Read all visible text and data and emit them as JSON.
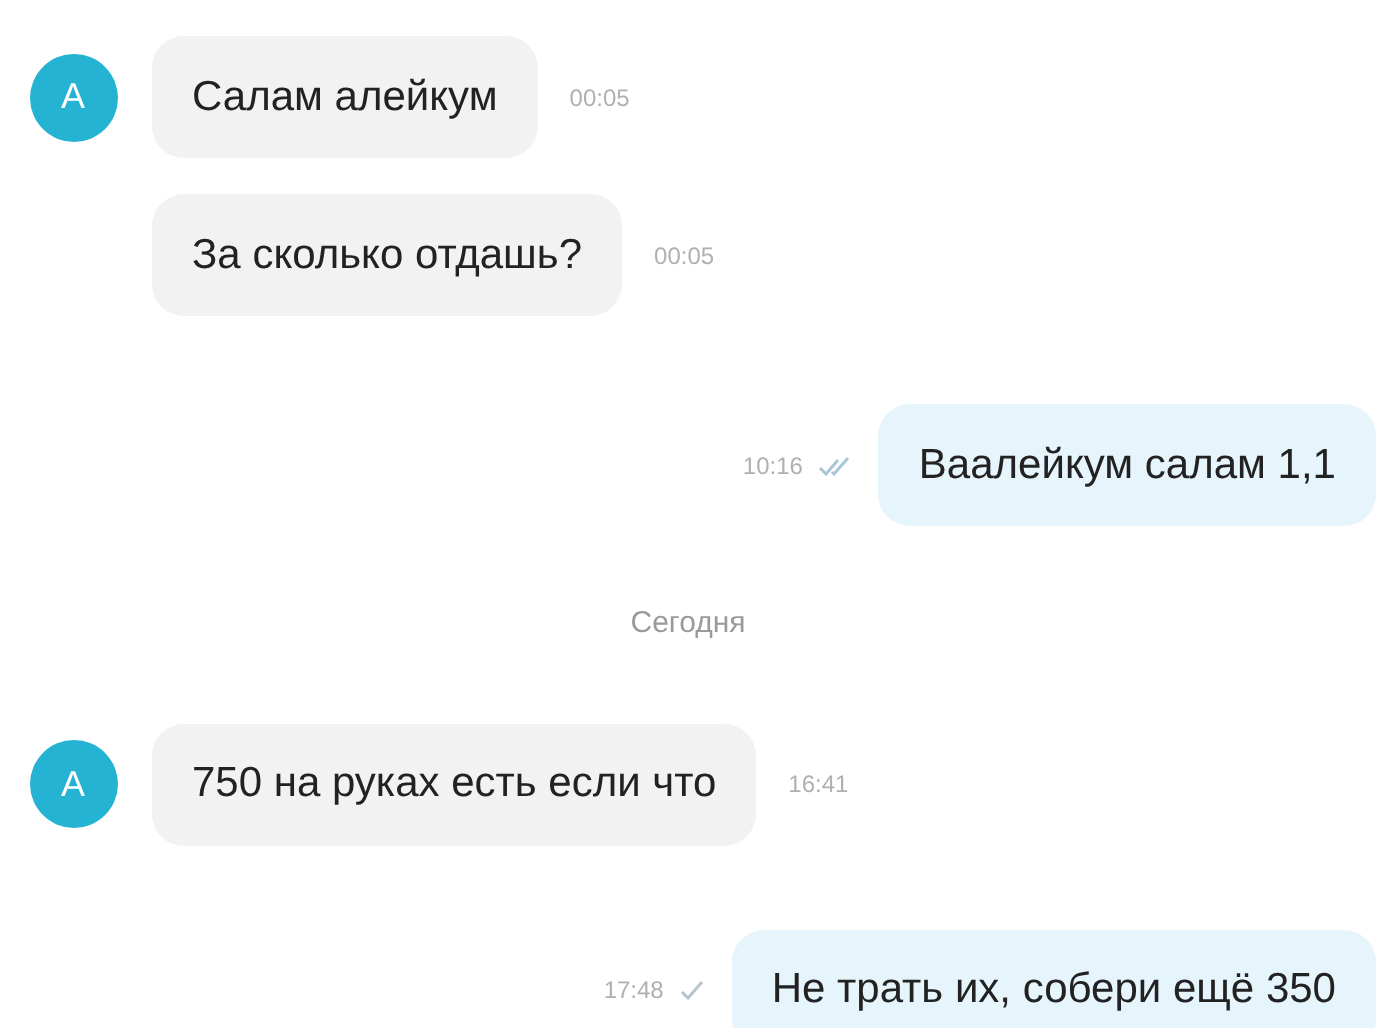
{
  "messages": [
    {
      "kind": "incoming",
      "avatar": "A",
      "text": "Салам алейкум",
      "time": "00:05"
    },
    {
      "kind": "incoming",
      "text": "За сколько отдашь?",
      "time": "00:05"
    },
    {
      "kind": "outgoing",
      "text": "Ваалейкум салам 1,1",
      "time": "10:16",
      "read": true
    },
    {
      "kind": "date",
      "text": "Сегодня"
    },
    {
      "kind": "incoming",
      "avatar": "A",
      "text": "750 на руках есть если что",
      "time": "16:41"
    },
    {
      "kind": "outgoing",
      "text": "Не трать их, собери ещё 350",
      "time": "17:48",
      "read": false
    }
  ]
}
